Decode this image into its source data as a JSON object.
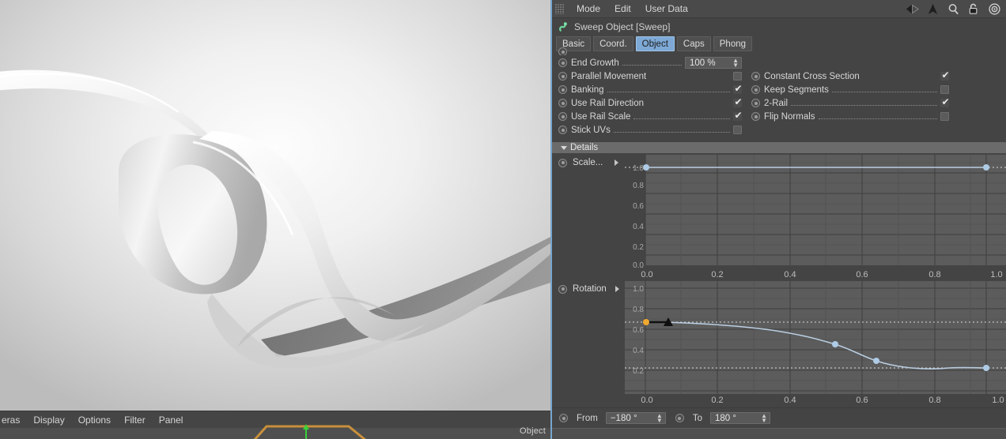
{
  "viewport": {
    "menus": [
      "eras",
      "Display",
      "Options",
      "Filter",
      "Panel"
    ],
    "object_label": "Object",
    "render_description": "grey glossy sweep ribbon on light studio background"
  },
  "panel": {
    "menubar": {
      "grip": "drag-grip",
      "items": [
        "Mode",
        "Edit",
        "User Data"
      ],
      "icons": [
        "back-arrow-icon",
        "up-arrow-icon",
        "search-icon",
        "lock-icon",
        "target-icon"
      ]
    },
    "object_title": "Sweep Object [Sweep]",
    "object_icon": "sweep-object-icon",
    "tabs": [
      {
        "label": "Basic",
        "active": false
      },
      {
        "label": "Coord.",
        "active": false
      },
      {
        "label": "Object",
        "active": true
      },
      {
        "label": "Caps",
        "active": false
      },
      {
        "label": "Phong",
        "active": false
      }
    ],
    "properties": {
      "left_column": [
        {
          "label": "End Growth",
          "type": "number",
          "value": "100 %"
        },
        {
          "label": "Parallel Movement",
          "type": "checkbox",
          "checked": false
        },
        {
          "label": "Banking",
          "type": "checkbox",
          "checked": true
        },
        {
          "label": "Use Rail Direction",
          "type": "checkbox",
          "checked": true
        },
        {
          "label": "Use Rail Scale",
          "type": "checkbox",
          "checked": true
        },
        {
          "label": "Stick UVs",
          "type": "checkbox",
          "checked": false
        }
      ],
      "right_column": [
        {
          "label": "Constant Cross Section",
          "type": "checkbox",
          "checked": true
        },
        {
          "label": "Keep Segments",
          "type": "checkbox",
          "checked": false
        },
        {
          "label": "2-Rail",
          "type": "checkbox",
          "checked": true
        },
        {
          "label": "Flip Normals",
          "type": "checkbox",
          "checked": false
        }
      ]
    },
    "details": {
      "header": "Details",
      "expanded": true
    },
    "scale_row": {
      "label": "Scale..."
    },
    "rotation_row": {
      "label": "Rotation"
    },
    "from_to": {
      "from_label": "From",
      "from_value": "−180 °",
      "to_label": "To",
      "to_value": "180 °"
    }
  },
  "chart_data": [
    {
      "type": "line",
      "title": "Scale",
      "xlabel": "",
      "ylabel": "",
      "xlim": [
        0.0,
        1.0
      ],
      "ylim": [
        0.0,
        1.0
      ],
      "xticks": [
        0.0,
        0.2,
        0.4,
        0.6,
        0.8,
        1.0
      ],
      "xticklabels": [
        "0.0",
        "0.2",
        "0.4",
        "0.6",
        "0.8",
        "1.0"
      ],
      "yticks": [
        0.0,
        0.2,
        0.4,
        0.6,
        0.8,
        1.0
      ],
      "yticklabels": [
        "0.0",
        "0.2",
        "0.4",
        "0.6",
        "0.8",
        "1.0"
      ],
      "grid": true,
      "line_color": "#b9cde0",
      "point_color": "#aecbe6",
      "knots": [
        {
          "x": 0.0,
          "y": 1.0
        },
        {
          "x": 1.0,
          "y": 1.0
        }
      ],
      "points": [
        [
          0.0,
          1.0
        ],
        [
          1.0,
          1.0
        ]
      ],
      "guide_lines_y": [
        1.0
      ]
    },
    {
      "type": "line",
      "title": "Rotation",
      "xlabel": "",
      "ylabel": "",
      "xlim": [
        0.0,
        1.0
      ],
      "ylim": [
        0.0,
        1.0
      ],
      "xticks": [
        0.0,
        0.2,
        0.4,
        0.6,
        0.8,
        1.0
      ],
      "xticklabels": [
        "0.0",
        "0.2",
        "0.4",
        "0.6",
        "0.8",
        "1.0"
      ],
      "yticks": [
        0.2,
        0.4,
        0.6,
        0.8,
        1.0
      ],
      "yticklabels": [
        "0.2",
        "0.4",
        "0.6",
        "0.8",
        "1.0"
      ],
      "grid": true,
      "line_color": "#b9cde0",
      "point_color": "#aecbe6",
      "knots": [
        {
          "x": 0.0,
          "y": 0.695,
          "handle": "orange-knot"
        },
        {
          "x": 0.06,
          "y": 0.695,
          "handle": "black-tangent-triangle"
        },
        {
          "x": 0.555,
          "y": 0.555
        },
        {
          "x": 0.665,
          "y": 0.415
        },
        {
          "x": 1.0,
          "y": 0.245
        }
      ],
      "points": [
        [
          0.0,
          0.695
        ],
        [
          0.2,
          0.685
        ],
        [
          0.4,
          0.655
        ],
        [
          0.555,
          0.555
        ],
        [
          0.665,
          0.415
        ],
        [
          0.8,
          0.33
        ],
        [
          1.0,
          0.245
        ]
      ],
      "guide_lines_y": [
        0.695,
        0.245
      ]
    }
  ]
}
